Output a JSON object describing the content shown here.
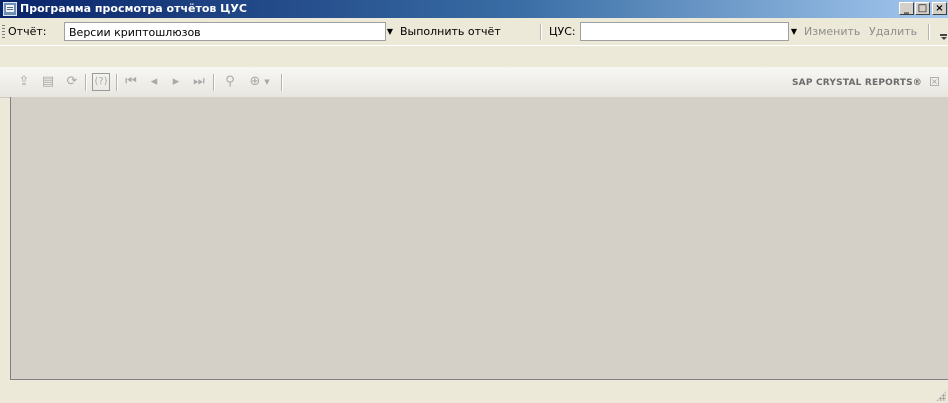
{
  "window": {
    "title": "Программа просмотра отчётов ЦУС",
    "controls": {
      "minimize": "_",
      "maximize": "□",
      "close": "×"
    }
  },
  "report_toolbar": {
    "report_label": "Отчёт:",
    "report_value": "Версии криптошлюзов",
    "run_label": "Выполнить отчёт",
    "cus_label": "ЦУС:",
    "cus_value": "",
    "edit_label": "Изменить",
    "delete_label": "Удалить"
  },
  "viewer_toolbar": {
    "icons": [
      "export-icon",
      "print-icon",
      "refresh-icon",
      "help-icon",
      "first-page-icon",
      "previous-page-icon",
      "next-page-icon",
      "last-page-icon",
      "find-icon",
      "zoom-icon"
    ],
    "help_text": "(?)",
    "brand": "SAP CRYSTAL REPORTS®"
  },
  "colors": {
    "title_gradient_start": "#0a246a",
    "title_gradient_end": "#a6caf0",
    "viewer_background": "#d4d0c8",
    "disabled_text": "#8e8e8e"
  }
}
